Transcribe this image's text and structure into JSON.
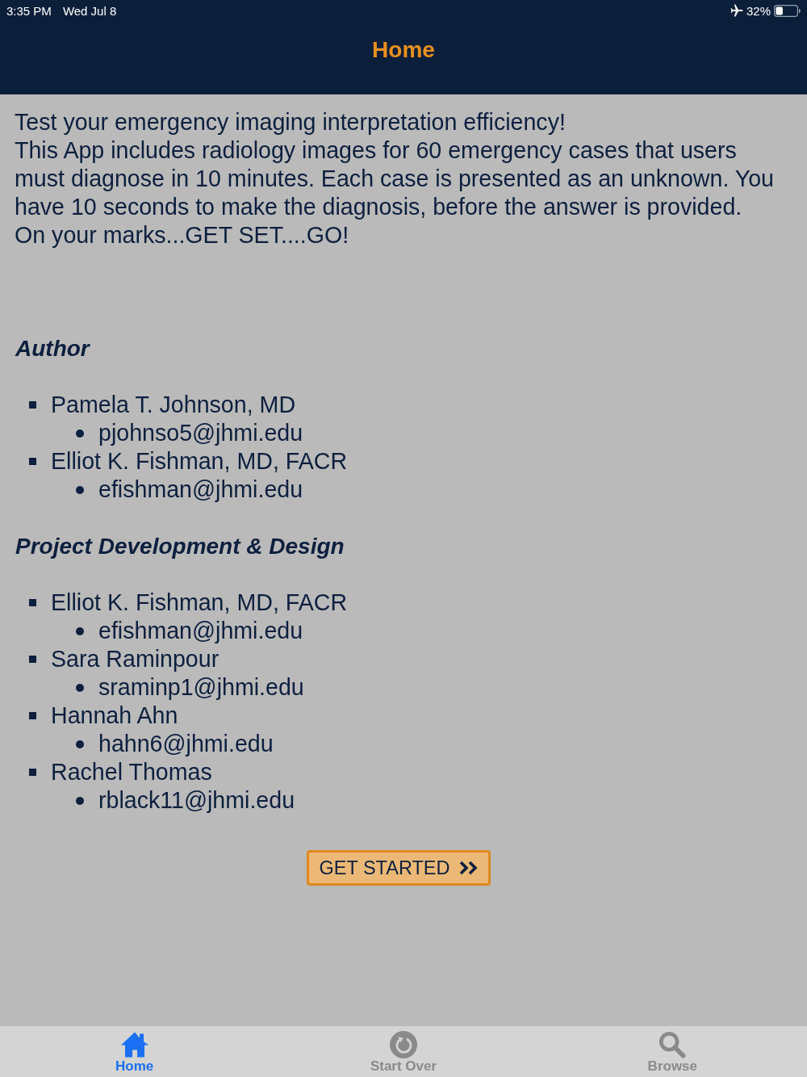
{
  "status_bar": {
    "time": "3:35 PM",
    "date": "Wed Jul 8",
    "battery": "32%"
  },
  "nav_bar": {
    "title": "Home"
  },
  "intro": [
    "Test your emergency imaging interpretation efficiency!",
    "This App includes radiology images for 60 emergency cases that users must diagnose in 10 minutes. Each case is presented as an unknown. You have 10 seconds to make the diagnosis, before the answer is provided.",
    "On your marks...GET SET....GO!"
  ],
  "sections": [
    {
      "heading": "Author",
      "people": [
        {
          "name": "Pamela T. Johnson, MD",
          "emails": [
            "pjohnso5@jhmi.edu"
          ]
        },
        {
          "name": "Elliot K. Fishman, MD, FACR",
          "emails": [
            "efishman@jhmi.edu"
          ]
        }
      ]
    },
    {
      "heading": "Project Development & Design",
      "people": [
        {
          "name": "Elliot K. Fishman, MD, FACR",
          "emails": [
            "efishman@jhmi.edu"
          ]
        },
        {
          "name": "Sara Raminpour",
          "emails": [
            "sraminp1@jhmi.edu"
          ]
        },
        {
          "name": "Hannah Ahn",
          "emails": [
            "hahn6@jhmi.edu"
          ]
        },
        {
          "name": "Rachel Thomas",
          "emails": [
            "rblack11@jhmi.edu"
          ]
        }
      ]
    }
  ],
  "start_button": {
    "label": "GET STARTED"
  },
  "tab_bar": [
    {
      "kind": "home",
      "label": "Home",
      "selected": true
    },
    {
      "kind": "restart",
      "label": "Start Over",
      "selected": false
    },
    {
      "kind": "search",
      "label": "Browse",
      "selected": false
    }
  ]
}
